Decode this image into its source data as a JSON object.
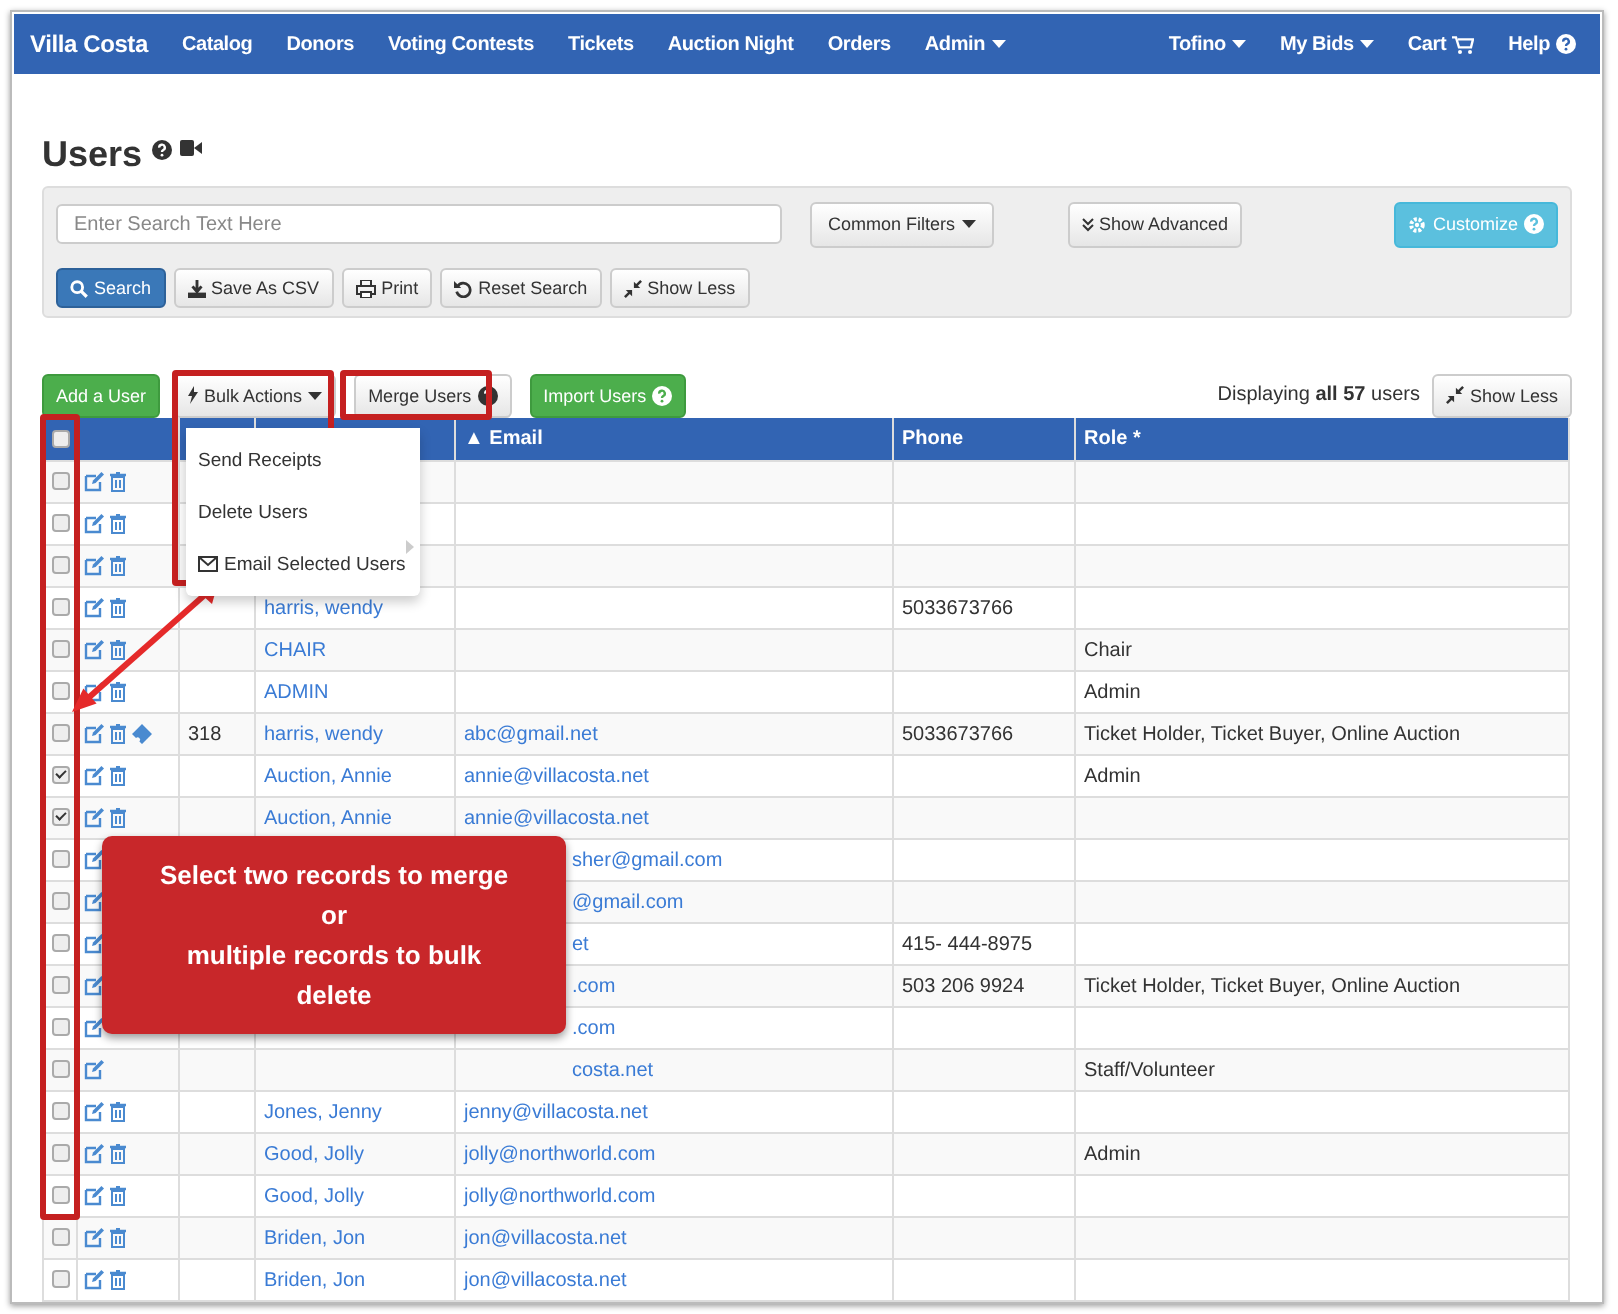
{
  "navbar": {
    "brand": "Villa Costa",
    "left": [
      {
        "label": "Catalog",
        "caret": false
      },
      {
        "label": "Donors",
        "caret": false
      },
      {
        "label": "Voting Contests",
        "caret": false
      },
      {
        "label": "Tickets",
        "caret": false
      },
      {
        "label": "Auction Night",
        "caret": false
      },
      {
        "label": "Orders",
        "caret": false
      },
      {
        "label": "Admin",
        "caret": true
      }
    ],
    "right": [
      {
        "label": "Tofino",
        "caret": true
      },
      {
        "label": "My Bids",
        "caret": true
      },
      {
        "label": "Cart",
        "caret": false
      },
      {
        "label": "Help",
        "caret": false
      }
    ]
  },
  "page_title": "Users",
  "search": {
    "placeholder": "Enter Search Text Here",
    "common_filters": "Common Filters",
    "show_advanced": "Show Advanced",
    "customize": "Customize",
    "buttons": [
      {
        "label": "Search",
        "primary": true
      },
      {
        "label": "Save As CSV",
        "primary": false
      },
      {
        "label": "Print",
        "primary": false
      },
      {
        "label": "Reset Search",
        "primary": false
      },
      {
        "label": "Show Less",
        "primary": false
      }
    ]
  },
  "toolbar": {
    "add_user": "Add a User",
    "bulk_actions": "Bulk Actions",
    "merge_users": "Merge Users",
    "import_users": "Import Users",
    "displaying": "Displaying **all 57** users",
    "show_less": "Show Less"
  },
  "bulk_menu": [
    "Send Receipts",
    "Delete Users",
    "Email Selected Users"
  ],
  "table": {
    "select_all": false,
    "columns": [
      "▲ Email",
      "Phone",
      "Role *"
    ],
    "rows": [
      {
        "checked": false,
        "ticket": false
      },
      {
        "checked": false,
        "ticket": false
      },
      {
        "checked": false,
        "ticket": false
      },
      {
        "checked": false,
        "ticket": false,
        "name": "harris, wendy",
        "phone": "5033673766"
      },
      {
        "checked": false,
        "ticket": false,
        "name": "CHAIR",
        "role": "Chair"
      },
      {
        "checked": false,
        "ticket": false,
        "name": "ADMIN",
        "role": "Admin"
      },
      {
        "checked": false,
        "ticket": true,
        "id": "318",
        "name": "harris, wendy",
        "email": "abc@gmail.net",
        "phone": "5033673766",
        "role": "Ticket Holder, Ticket Buyer, Online Auction"
      },
      {
        "checked": true,
        "ticket": false,
        "name": "Auction, Annie",
        "email": "annie@villacosta.net",
        "role": "Admin"
      },
      {
        "checked": true,
        "ticket": false,
        "name": "Auction, Annie",
        "email": "annie@villacosta.net"
      },
      {
        "checked": false,
        "email_tail": "sher@gmail.com"
      },
      {
        "checked": false,
        "email_tail": "@gmail.com"
      },
      {
        "checked": false,
        "email_tail": "et",
        "phone": "415- 444-8975"
      },
      {
        "checked": false,
        "email_tail": ".com",
        "phone": "503 206 9924",
        "role": "Ticket Holder, Ticket Buyer, Online Auction"
      },
      {
        "checked": false,
        "email_tail": ".com"
      },
      {
        "checked": false,
        "email_tail": "costa.net",
        "role": "Staff/Volunteer"
      },
      {
        "checked": false,
        "ticket": false,
        "name": "Jones, Jenny",
        "email": "jenny@villacosta.net"
      },
      {
        "checked": false,
        "ticket": false,
        "name": "Good, Jolly",
        "email": "jolly@northworld.com",
        "role": "Admin"
      },
      {
        "checked": false,
        "ticket": false,
        "name": "Good, Jolly",
        "email": "jolly@northworld.com"
      },
      {
        "checked": false,
        "ticket": false,
        "name": "Briden, Jon",
        "email": "jon@villacosta.net"
      },
      {
        "checked": false,
        "ticket": false,
        "name": "Briden, Jon",
        "email": "jon@villacosta.net"
      }
    ]
  },
  "callout": {
    "lines": [
      "Select two records to merge",
      "or",
      "multiple records to bulk delete"
    ]
  }
}
